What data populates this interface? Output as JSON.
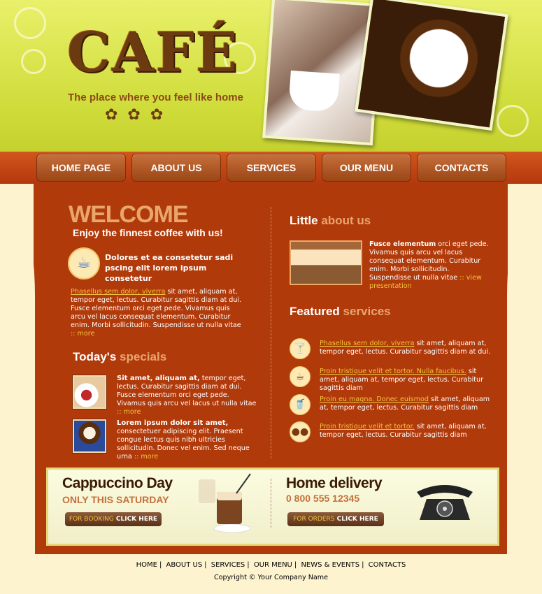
{
  "brand": {
    "logo": "CAFÉ",
    "tagline": "The place where you feel like home"
  },
  "nav": {
    "items": [
      "HOME PAGE",
      "ABOUT US",
      "SERVICES",
      "OUR MENU",
      "CONTACTS"
    ]
  },
  "welcome": {
    "title": "WELCOME",
    "subtitle": "Enjoy the finnest coffee with us!",
    "intro": "Dolores et ea consetetur sadi pscing elit lorem ipsum consetetur",
    "link": "Phasellus sem dolor, viverra",
    "body": " sit amet, aliquam at, tempor eget, lectus. Curabitur sagittis diam at dui. Fusce elementum orci eget pede. Vivamus quis arcu vel lacus consequat elementum. Curabitur enim. Morbi sollicitudin. Suspendisse ut nulla vitae",
    "more": ":: more"
  },
  "specials": {
    "title_main": "Today's",
    "title_accent": "specials",
    "items": [
      {
        "bold": "Sit amet, aliquam at,",
        "text": " tempor eget, lectus. Curabitur sagittis diam at dui. Fusce elementum orci eget pede. Vivamus quis arcu vel lacus ut nulla vitae",
        "more": ":: more"
      },
      {
        "bold": "Lorem ipsum dolor sit amet,",
        "text": " consectetuer adipiscing elit. Praesent congue lectus quis nibh ultricies sollicitudin. Donec vel enim. Sed neque urna",
        "more": ":: more"
      }
    ]
  },
  "about": {
    "title_main": "Little",
    "title_accent": "about us",
    "bold": "Fusce elementum",
    "text": " orci eget pede. Vivamus quis arcu vel lacus consequat elementum. Curabitur enim. Morbi sollicitudin. Suspendisse ut nulla vitae",
    "link": ":: view presentation"
  },
  "featured": {
    "title_main": "Featured",
    "title_accent": "services",
    "items": [
      {
        "link": "Phasellus sem dolor, viverra",
        "text": " sit amet, aliquam at, tempor eget, lectus. Curabitur sagittis diam at dui."
      },
      {
        "link": "Proin tristique velit et tortor. Nulla faucibus.",
        "text": " sit amet, aliquam at, tempor eget, lectus. Curabitur sagittis diam"
      },
      {
        "link": "Proin eu magna. Donec euismod",
        "text": " sit amet, aliquam at, tempor eget, lectus. Curabitur sagittis diam"
      },
      {
        "link": "Proin tristique velit et tortor.",
        "text": " sit amet, aliquam at, tempor eget, lectus. Curabitur sagittis diam"
      }
    ]
  },
  "promo": {
    "cappuccino": {
      "title": "Cappuccino Day",
      "sub": "ONLY THIS SATURDAY",
      "btn_yellow": "FOR BOOKING",
      "btn_white": "CLICK HERE"
    },
    "delivery": {
      "title": "Home delivery",
      "sub": "0 800 555 12345",
      "btn_yellow": "FOR ORDERS",
      "btn_white": "CLICK HERE"
    }
  },
  "footer": {
    "links": [
      "HOME",
      "ABOUT US",
      "SERVICES",
      "OUR MENU",
      "NEWS & EVENTS",
      "CONTACTS"
    ],
    "copyright": "Copyright © Your Company Name"
  },
  "colors": {
    "header_green": "#d5e03e",
    "main_rust": "#b13a0b",
    "accent_tan": "#e8a66d",
    "link_yellow": "#f3c33c"
  }
}
